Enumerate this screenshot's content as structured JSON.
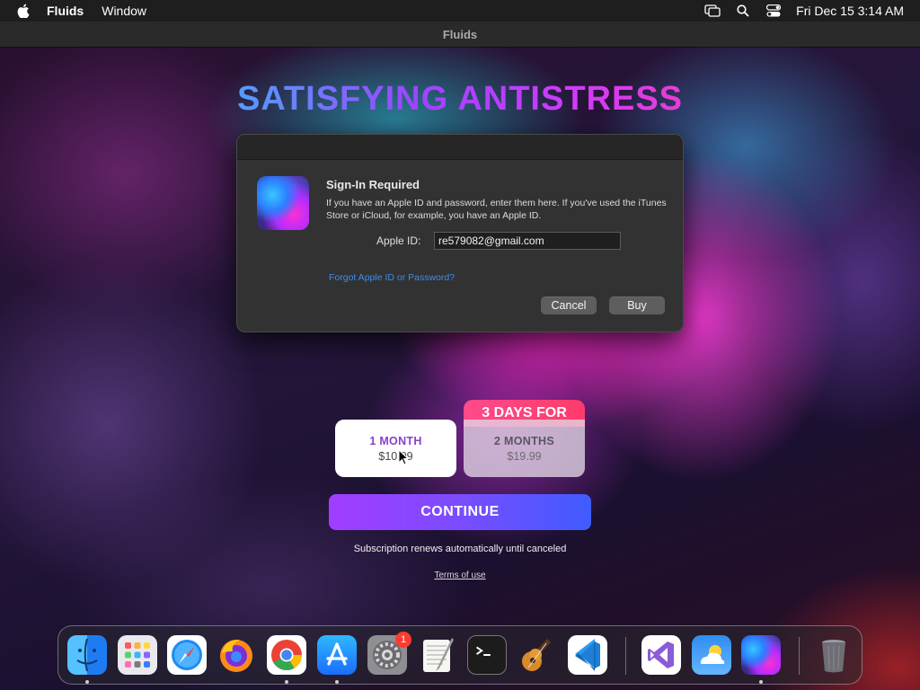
{
  "menubar": {
    "app_name": "Fluids",
    "menu_window": "Window",
    "clock": "Fri Dec 15  3:14 AM"
  },
  "window": {
    "title": "Fluids"
  },
  "content": {
    "headline": "SATISFYING ANTISTRESS",
    "plans": [
      {
        "name": "1 MONTH",
        "price": "$10.99"
      },
      {
        "name": "2 MONTHS",
        "price": "$19.99",
        "promo": "3 DAYS FOR"
      }
    ],
    "continue_label": "CONTINUE",
    "renew_text": "Subscription renews automatically until canceled",
    "terms_link": "Terms of use"
  },
  "dialog": {
    "title": "Sign-In Required",
    "message": "If you have an Apple ID and password, enter them here. If you've used the iTunes Store or iCloud, for example, you have an Apple ID.",
    "apple_id_label": "Apple ID:",
    "apple_id_value": "re579082@gmail.com",
    "forgot_link": "Forgot Apple ID or Password?",
    "cancel_label": "Cancel",
    "buy_label": "Buy"
  },
  "dock": {
    "settings_badge": "1",
    "apps": [
      "finder",
      "launchpad",
      "safari",
      "firefox",
      "chrome",
      "app-store",
      "system-settings",
      "textedit",
      "terminal",
      "garageband",
      "vscode",
      "visual-studio",
      "weather",
      "fluids",
      "trash"
    ]
  }
}
